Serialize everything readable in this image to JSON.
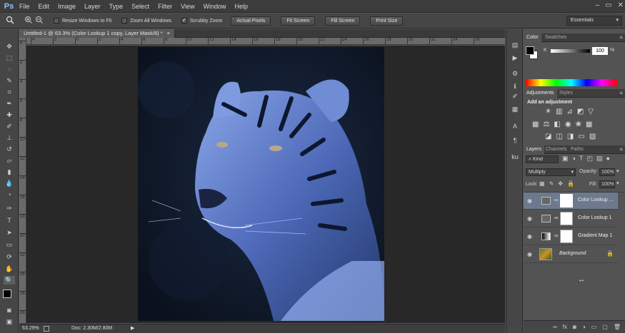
{
  "app": {
    "logo": "Ps"
  },
  "menu": [
    "File",
    "Edit",
    "Image",
    "Layer",
    "Type",
    "Select",
    "Filter",
    "View",
    "Window",
    "Help"
  ],
  "window_controls": [
    "–",
    "▭",
    "✕"
  ],
  "options_bar": {
    "checkboxes": [
      {
        "label": "Resize Windows to Fit",
        "checked": false
      },
      {
        "label": "Zoom All Windows",
        "checked": false
      },
      {
        "label": "Scrubby Zoom",
        "checked": true
      }
    ],
    "buttons": [
      "Actual Pixels",
      "Fit Screen",
      "Fill Screen",
      "Print Size"
    ],
    "workspace": "Essentials"
  },
  "document": {
    "tab_title": "Untitled-1 @ 63.3% (Color Lookup 1 copy, Layer Mask/8) *",
    "ruler_top": [
      "4",
      "2",
      "0",
      "2",
      "4",
      "6",
      "8",
      "10",
      "12",
      "14",
      "16",
      "18",
      "20",
      "22",
      "24",
      "26",
      "28",
      "30",
      "32",
      "34",
      "36"
    ],
    "ruler_left": [
      "0",
      "2",
      "4",
      "6",
      "8",
      "10",
      "12",
      "14",
      "16",
      "18",
      "20",
      "22",
      "24",
      "26",
      "28"
    ]
  },
  "status": {
    "zoom": "63.29%",
    "doc": "Doc: 2.30M/2.80M"
  },
  "color_panel": {
    "tabs": [
      "Color",
      "Swatches"
    ],
    "channel": "K",
    "value": "100",
    "unit": "%"
  },
  "adjustments_panel": {
    "tabs": [
      "Adjustments",
      "Styles"
    ],
    "heading": "Add an adjustment"
  },
  "layers_panel": {
    "tabs": [
      "Layers",
      "Channels",
      "Paths"
    ],
    "filter": "Kind",
    "blend_mode": "Multiply",
    "opacity_label": "Opacity:",
    "opacity": "100%",
    "lock_label": "Lock:",
    "fill_label": "Fill:",
    "fill": "100%",
    "layers": [
      {
        "name": "Color Lookup ...",
        "selected": true
      },
      {
        "name": "Color Lookup 1",
        "selected": false
      },
      {
        "name": "Gradient Map 1",
        "selected": false
      },
      {
        "name": "Background",
        "selected": false
      }
    ]
  },
  "colors": {
    "accent_selection": "#6d7a8d",
    "panel_bg": "#535353",
    "image_tint": "#5a78c8"
  }
}
